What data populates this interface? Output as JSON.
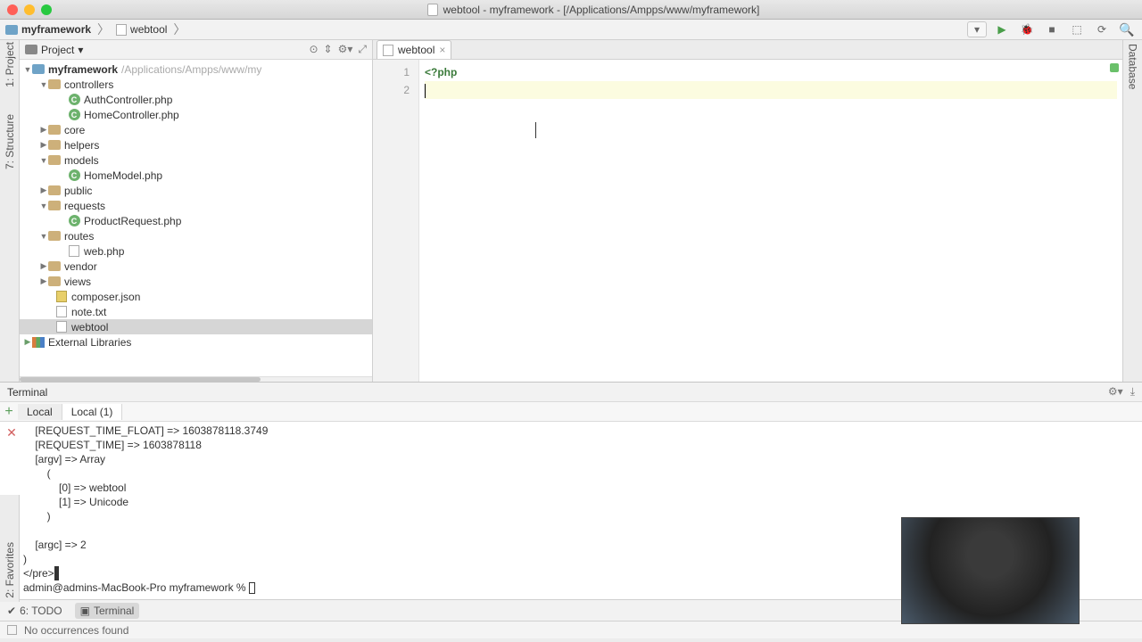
{
  "titlebar": {
    "title": "webtool - myframework - [/Applications/Ampps/www/myframework]"
  },
  "breadcrumb": {
    "project": "myframework",
    "file": "webtool"
  },
  "toolbar_right": {
    "dropdown": "▾",
    "run": "▶"
  },
  "left_tabs": {
    "project": "1: Project",
    "structure": "7: Structure",
    "favorites": "2: Favorites"
  },
  "right_tabs": {
    "database": "Database"
  },
  "project_header": {
    "label": "Project"
  },
  "tree": {
    "root": {
      "name": "myframework",
      "path": "/Applications/Ampps/www/my"
    },
    "controllers": {
      "name": "controllers",
      "f1": "AuthController.php",
      "f2": "HomeController.php"
    },
    "core": "core",
    "helpers": "helpers",
    "models": {
      "name": "models",
      "f1": "HomeModel.php"
    },
    "public": "public",
    "requests": {
      "name": "requests",
      "f1": "ProductRequest.php"
    },
    "routes": {
      "name": "routes",
      "f1": "web.php"
    },
    "vendor": "vendor",
    "views": "views",
    "composer": "composer.json",
    "note": "note.txt",
    "webtool": "webtool",
    "ext": "External Libraries"
  },
  "editor": {
    "tab": "webtool",
    "lines": {
      "l1": "1",
      "l2": "2"
    },
    "code1": "<?php",
    "code2": ""
  },
  "terminal": {
    "title": "Terminal",
    "tabs": {
      "t1": "Local",
      "t2": "Local (1)"
    },
    "out": "    [REQUEST_TIME_FLOAT] => 1603878118.3749\n    [REQUEST_TIME] => 1603878118\n    [argv] => Array\n        (\n            [0] => webtool\n            [1] => Unicode\n        )\n\n    [argc] => 2\n)\n</pre>",
    "prompt": "admin@admins-MacBook-Pro myframework % "
  },
  "bottom_tools": {
    "todo": "6: TODO",
    "terminal": "Terminal"
  },
  "status": {
    "msg": "No occurrences found"
  }
}
